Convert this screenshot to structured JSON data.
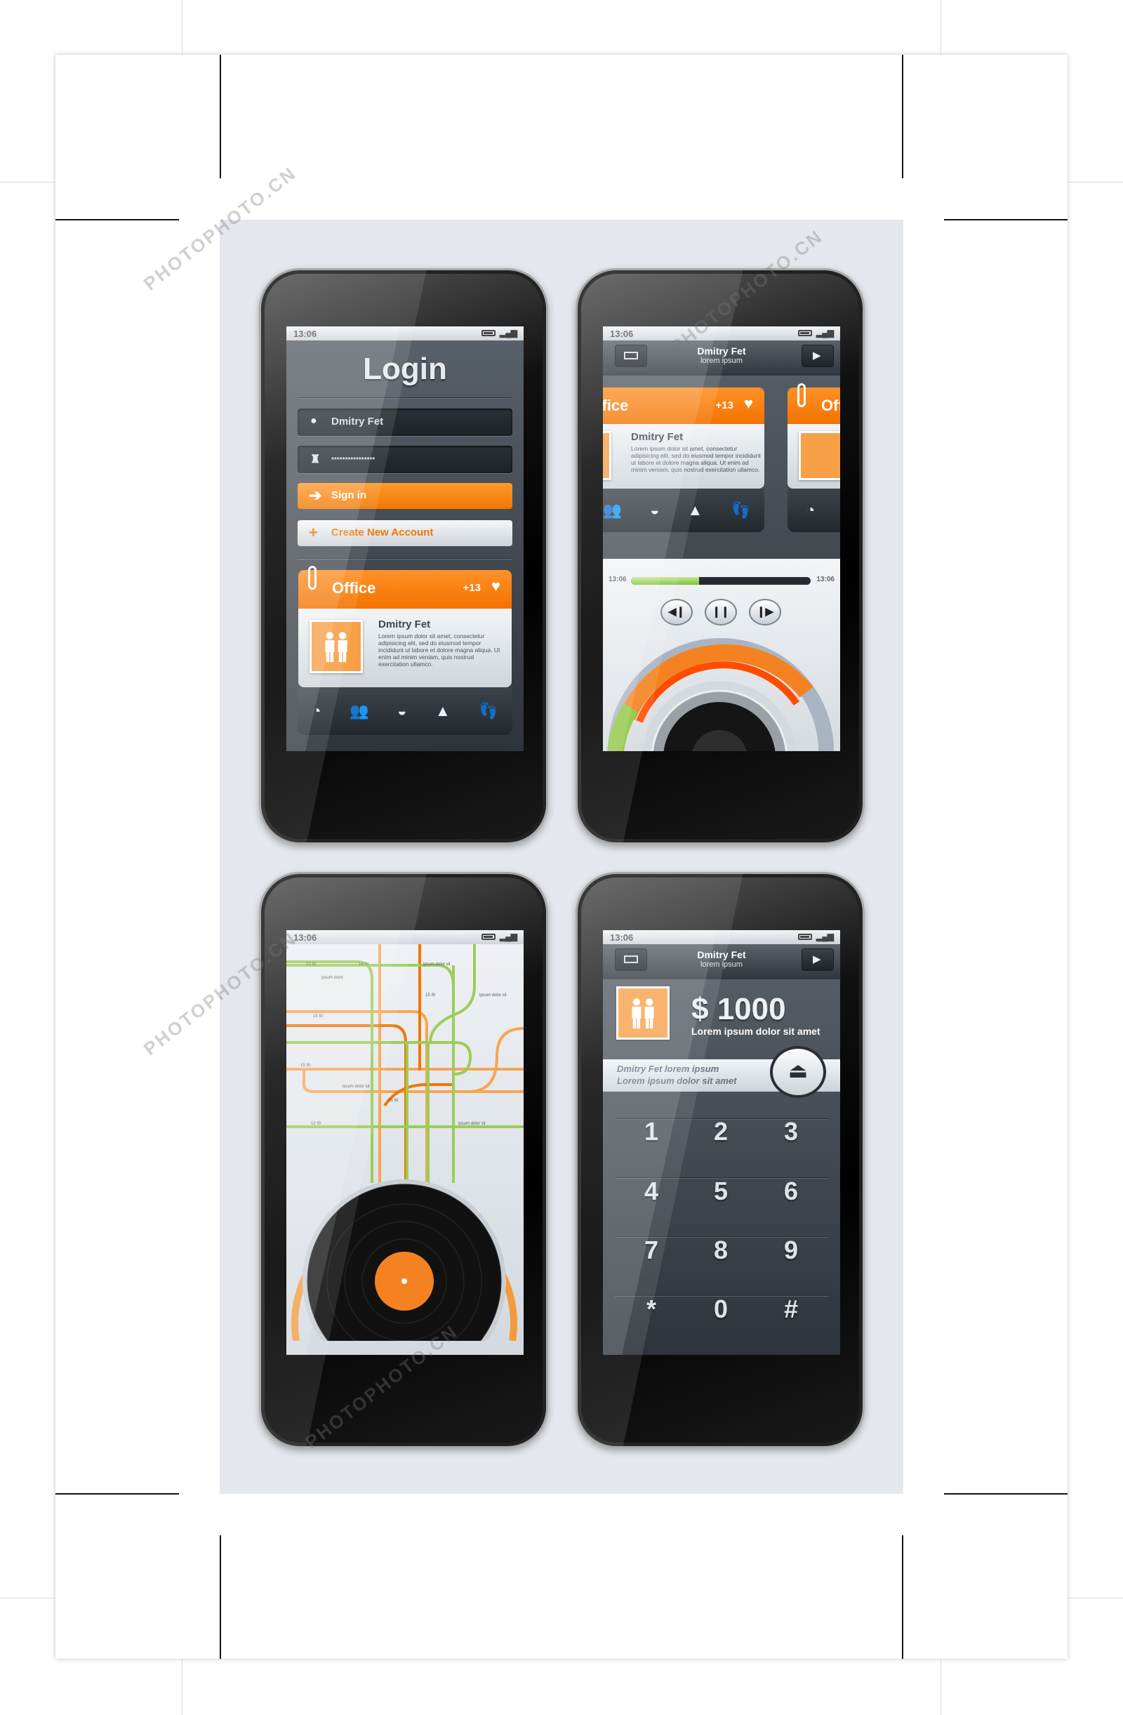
{
  "status": {
    "time": "13:06"
  },
  "login": {
    "title": "Login",
    "username": "Dmitry Fet",
    "password": "****************",
    "sign_in": "Sign in",
    "create_account": "Create New Account",
    "card": {
      "title": "Office",
      "count": "+13",
      "name": "Dmitry Fet",
      "body": "Lorem ipsum dolor sit amet, consectetur adipisicing elit, sed do eiusmod tempor incididunt ut labore et dolore magna aliqua. Ut enim ad minim veniam, quis nostrud exercitation ullamco."
    },
    "icons": [
      "clock-icon",
      "people-icon",
      "basket-icon",
      "tent-icon",
      "footprints-icon"
    ]
  },
  "music": {
    "header": {
      "name": "Dmitry Fet",
      "sub": "lorem ipsum"
    },
    "progress": {
      "start": "13:06",
      "end": "13:06",
      "value": 0.38
    },
    "controls": {
      "prev": "previous",
      "pause": "pause",
      "next": "next"
    },
    "gauge_colors": {
      "orange": "#f58220",
      "red": "#ff4d00",
      "green": "#8cc63f",
      "gray": "#a9b4c2"
    }
  },
  "map": {
    "labels": [
      "22 St",
      "12 St",
      "ipsum dolor sit",
      "ipsum dolor",
      "ipsum dolor sit",
      "15 St",
      "15 St",
      "15 St",
      "12 St",
      "ipsum dolor sit",
      "15 St",
      "ipsum dolor sit"
    ]
  },
  "dialer": {
    "header": {
      "name": "Dmitry Fet",
      "sub": "lorem ipsum"
    },
    "amount": "$ 1000",
    "amount_sub": "Lorem ipsum dolor sit amet",
    "strip_line1": "Dmitry Fet lorem ipsum",
    "strip_line2": "Lorem ipsum dolor sit amet",
    "keys": [
      "1",
      "2",
      "3",
      "4",
      "5",
      "6",
      "7",
      "8",
      "9",
      "*",
      "0",
      "#"
    ]
  },
  "colors": {
    "accent": "#f27300",
    "panel": "#e4e8ec",
    "screen": "#3d444c"
  },
  "watermark": "PHOTOPHOTO.CN"
}
